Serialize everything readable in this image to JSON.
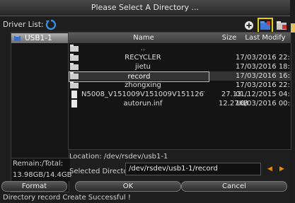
{
  "dialog": {
    "title": "Please Select A Directory ..."
  },
  "driver": {
    "label": "Driver List:",
    "items": [
      {
        "label": "USB1-1"
      }
    ]
  },
  "toolbar": {
    "icons": [
      "add-icon",
      "new-folder-icon",
      "delete-folder-icon"
    ]
  },
  "storage": {
    "label": "Remain:/Total:",
    "value": "13.98GB/14.4GB"
  },
  "table": {
    "headers": [
      "Name",
      "Size",
      "Last Modify"
    ],
    "rows": [
      {
        "type": "folder",
        "name": "..",
        "size": "",
        "date": ""
      },
      {
        "type": "folder",
        "name": "RECYCLER",
        "size": "",
        "date": "17/03/2016 22:..."
      },
      {
        "type": "folder",
        "name": "jietu",
        "size": "",
        "date": "17/03/2016 18:..."
      },
      {
        "type": "folder",
        "name": "record",
        "size": "",
        "date": "17/03/2016 16:...",
        "selected": true
      },
      {
        "type": "folder",
        "name": "zhongxing",
        "size": "",
        "date": "17/03/2016 22:..."
      },
      {
        "type": "file",
        "name": "N5008_V151009V151009V151126V151...",
        "size": "27.13...",
        "date": "01/12/2015 04:..."
      },
      {
        "type": "file",
        "name": "autorun.inf",
        "size": "12.27KB",
        "date": "18/03/2016 00:..."
      }
    ]
  },
  "location": {
    "label": "Location:",
    "value": "/dev/rsdev/usb1-1"
  },
  "selected_dir": {
    "label": "Selected Directory:",
    "value": "/dev/rsdev/usb1-1/record"
  },
  "buttons": {
    "format": "Format",
    "ok": "OK",
    "cancel": "Cancel"
  },
  "status": "Directory record Create Successful !",
  "colors": {
    "highlight": "#e8d100",
    "accent": "#e68a00",
    "panel": "#141414"
  }
}
